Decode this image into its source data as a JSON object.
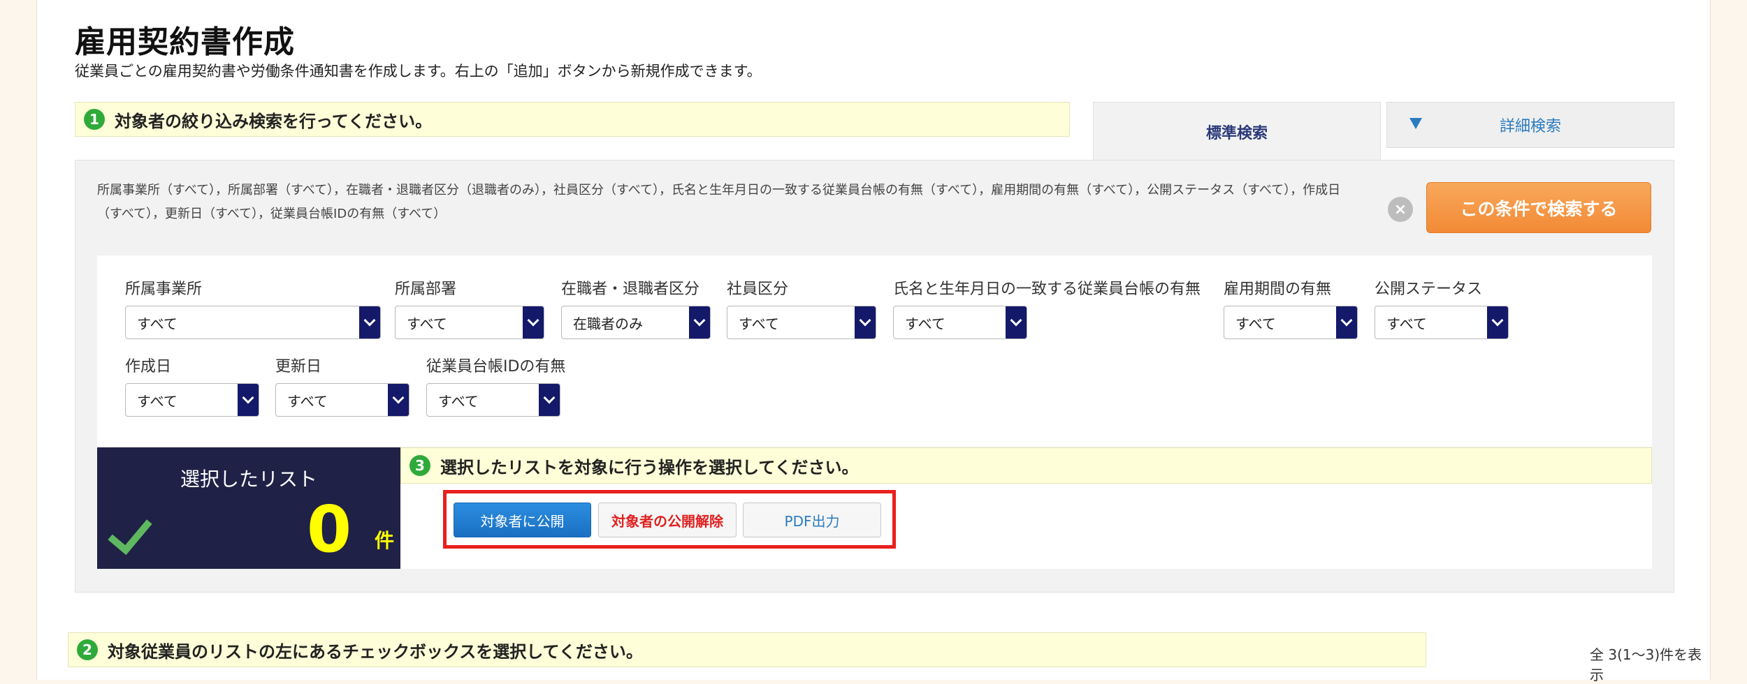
{
  "page": {
    "title": "雇用契約書作成",
    "subtitle": "従業員ごとの雇用契約書や労働条件通知書を作成します。右上の「追加」ボタンから新規作成できます。"
  },
  "step1": {
    "num": "1",
    "text": "対象者の絞り込み検索を行ってください。"
  },
  "tabs": {
    "standard": "標準検索",
    "detail": "詳細検索"
  },
  "conditions_summary": "所属事業所（すべて），所属部署（すべて），在職者・退職者区分（退職者のみ），社員区分（すべて），氏名と生年月日の一致する従業員台帳の有無（すべて），雇用期間の有無（すべて），公開ステータス（すべて），作成日（すべて），更新日（すべて），従業員台帳IDの有無（すべて）",
  "search_button": "この条件で検索する",
  "filters": [
    {
      "label": "所属事業所",
      "value": "すべて"
    },
    {
      "label": "所属部署",
      "value": "すべて"
    },
    {
      "label": "在職者・退職者区分",
      "value": "在職者のみ"
    },
    {
      "label": "社員区分",
      "value": "すべて"
    },
    {
      "label": "氏名と生年月日の一致する従業員台帳の有無",
      "value": "すべて"
    },
    {
      "label": "雇用期間の有無",
      "value": "すべて"
    },
    {
      "label": "公開ステータス",
      "value": "すべて"
    },
    {
      "label": "作成日",
      "value": "すべて"
    },
    {
      "label": "更新日",
      "value": "すべて"
    },
    {
      "label": "従業員台帳IDの有無",
      "value": "すべて"
    }
  ],
  "selected_list": {
    "title": "選択したリスト",
    "count": "0",
    "unit": "件"
  },
  "step3": {
    "num": "3",
    "text": "選択したリストを対象に行う操作を選択してください。"
  },
  "operations": {
    "publish": "対象者に公開",
    "unpublish": "対象者の公開解除",
    "pdf": "PDF出力"
  },
  "step2": {
    "num": "2",
    "text": "対象従業員のリストの左にあるチェックボックスを選択してください。"
  },
  "result_count": "全 3(1〜3)件を表示",
  "icons": {
    "clear": "close-circle-icon",
    "check": "check-icon",
    "dropdown": "chevron-down-icon",
    "expand": "triangle-down-icon"
  },
  "colors": {
    "primary_button": "#1b6fc2",
    "search_button": "#f28a37",
    "step_badge": "#2faa3a",
    "highlight": "#e8201c",
    "list_box": "#1f2146",
    "count": "#ffff00"
  }
}
